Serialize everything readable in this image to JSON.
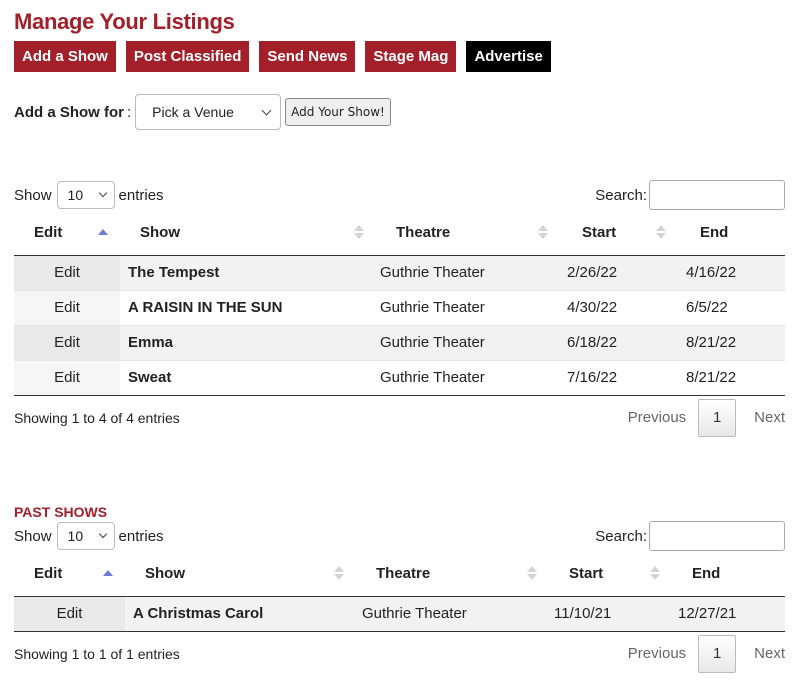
{
  "page_title": "Manage Your Listings",
  "nav": {
    "add_show": "Add a Show",
    "post_classified": "Post Classified",
    "send_news": "Send News",
    "stage_mag": "Stage Mag",
    "advertise": "Advertise"
  },
  "add_show_form": {
    "label": "Add a Show for",
    "colon": ":",
    "venue_selected": "Pick a Venue",
    "button": "Add Your Show!"
  },
  "current": {
    "length": {
      "show": "Show",
      "value": "10",
      "entries": "entries"
    },
    "search_label": "Search:",
    "columns": [
      "Edit",
      "Show",
      "Theatre",
      "Start",
      "End"
    ],
    "rows": [
      {
        "edit": "Edit",
        "show": "The Tempest",
        "theatre": "Guthrie Theater",
        "start": "2/26/22",
        "end": "4/16/22"
      },
      {
        "edit": "Edit",
        "show": "A RAISIN IN THE SUN",
        "theatre": "Guthrie Theater",
        "start": "4/30/22",
        "end": "6/5/22"
      },
      {
        "edit": "Edit",
        "show": "Emma",
        "theatre": "Guthrie Theater",
        "start": "6/18/22",
        "end": "8/21/22"
      },
      {
        "edit": "Edit",
        "show": "Sweat",
        "theatre": "Guthrie Theater",
        "start": "7/16/22",
        "end": "8/21/22"
      }
    ],
    "info": "Showing 1 to 4 of 4 entries",
    "pager": {
      "previous": "Previous",
      "page": "1",
      "next": "Next"
    }
  },
  "past": {
    "heading": "PAST SHOWS",
    "length": {
      "show": "Show",
      "value": "10",
      "entries": "entries"
    },
    "search_label": "Search:",
    "columns": [
      "Edit",
      "Show",
      "Theatre",
      "Start",
      "End"
    ],
    "rows": [
      {
        "edit": "Edit",
        "show": "A Christmas Carol",
        "theatre": "Guthrie Theater",
        "start": "11/10/21",
        "end": "12/27/21"
      }
    ],
    "info": "Showing 1 to 1 of 1 entries",
    "pager": {
      "previous": "Previous",
      "page": "1",
      "next": "Next"
    }
  },
  "colors": {
    "brand_red": "#a3202a",
    "black": "#000000",
    "sort_active": "#6d7ad8"
  },
  "icons": [
    "chevron-down-icon",
    "sort-asc-icon",
    "sort-both-icon"
  ]
}
